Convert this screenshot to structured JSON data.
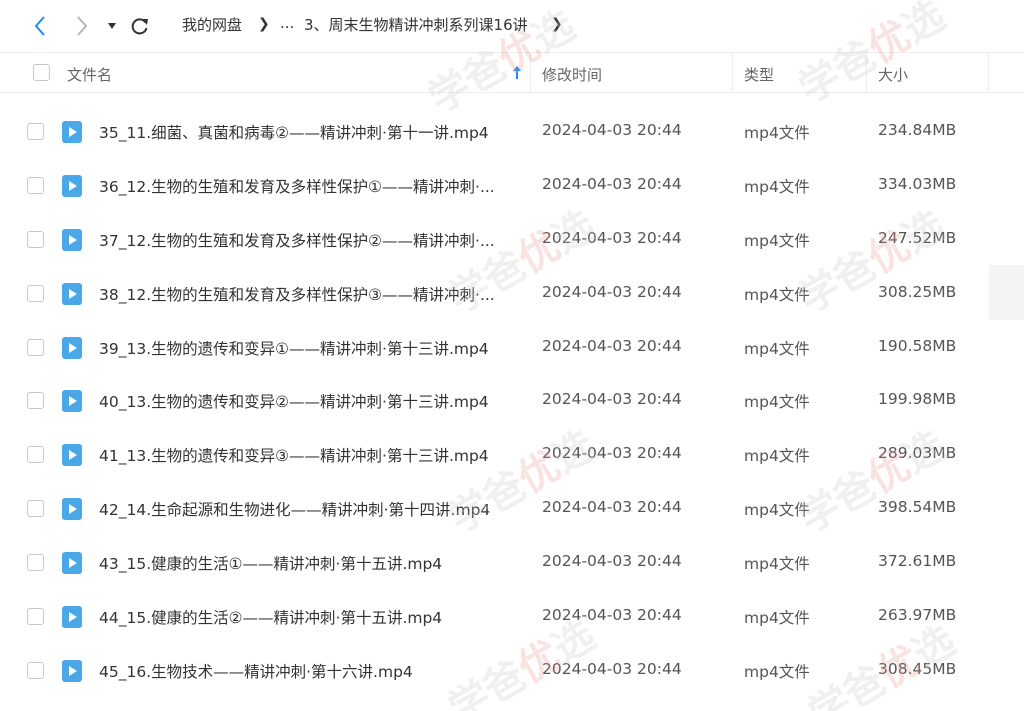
{
  "nav": {
    "breadcrumb_root": "我的网盘",
    "breadcrumb_ellipsis": "...",
    "breadcrumb_current": "3、周末生物精讲冲刺系列课16讲"
  },
  "header": {
    "name": "文件名",
    "modified": "修改时间",
    "type": "类型",
    "size": "大小"
  },
  "files": [
    {
      "name": "35_11.细菌、真菌和病毒②——精讲冲刺·第十一讲.mp4",
      "date": "2024-04-03 20:44",
      "type": "mp4文件",
      "size": "234.84MB"
    },
    {
      "name": "36_12.生物的生殖和发育及多样性保护①——精讲冲刺·...",
      "date": "2024-04-03 20:44",
      "type": "mp4文件",
      "size": "334.03MB"
    },
    {
      "name": "37_12.生物的生殖和发育及多样性保护②——精讲冲刺·...",
      "date": "2024-04-03 20:44",
      "type": "mp4文件",
      "size": "247.52MB"
    },
    {
      "name": "38_12.生物的生殖和发育及多样性保护③——精讲冲刺·...",
      "date": "2024-04-03 20:44",
      "type": "mp4文件",
      "size": "308.25MB"
    },
    {
      "name": "39_13.生物的遗传和变异①——精讲冲刺·第十三讲.mp4",
      "date": "2024-04-03 20:44",
      "type": "mp4文件",
      "size": "190.58MB"
    },
    {
      "name": "40_13.生物的遗传和变异②——精讲冲刺·第十三讲.mp4",
      "date": "2024-04-03 20:44",
      "type": "mp4文件",
      "size": "199.98MB"
    },
    {
      "name": "41_13.生物的遗传和变异③——精讲冲刺·第十三讲.mp4",
      "date": "2024-04-03 20:44",
      "type": "mp4文件",
      "size": "289.03MB"
    },
    {
      "name": "42_14.生命起源和生物进化——精讲冲刺·第十四讲.mp4",
      "date": "2024-04-03 20:44",
      "type": "mp4文件",
      "size": "398.54MB"
    },
    {
      "name": "43_15.健康的生活①——精讲冲刺·第十五讲.mp4",
      "date": "2024-04-03 20:44",
      "type": "mp4文件",
      "size": "372.61MB"
    },
    {
      "name": "44_15.健康的生活②——精讲冲刺·第十五讲.mp4",
      "date": "2024-04-03 20:44",
      "type": "mp4文件",
      "size": "263.97MB"
    },
    {
      "name": "45_16.生物技术——精讲冲刺·第十六讲.mp4",
      "date": "2024-04-03 20:44",
      "type": "mp4文件",
      "size": "308.45MB"
    }
  ],
  "watermark": {
    "part1": "学爸",
    "part2": "优",
    "part3": "选"
  },
  "colors": {
    "accent": "#1a8cff",
    "file_icon": "#4aa8e8",
    "border": "#eeeeee"
  }
}
